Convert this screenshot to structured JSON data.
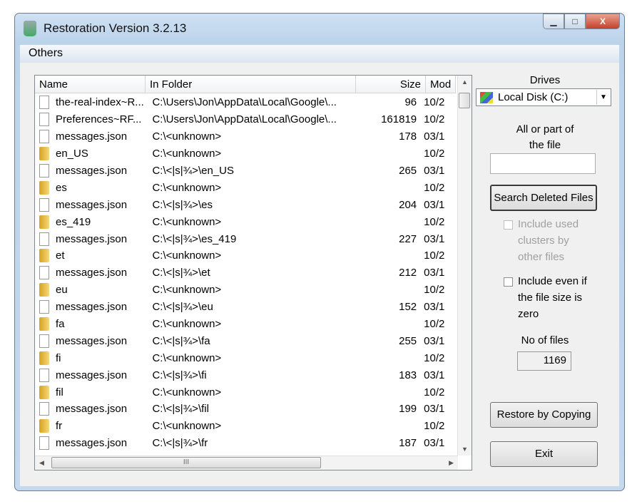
{
  "window": {
    "title": "Restoration Version 3.2.13",
    "minimize": "▁",
    "maximize": "□",
    "close": "X"
  },
  "menu": {
    "others": "Others"
  },
  "list": {
    "columns": [
      "Name",
      "In Folder",
      "Size",
      "Mod"
    ],
    "rows": [
      {
        "type": "file",
        "name": "the-real-index~R...",
        "folder": "C:\\Users\\Jon\\AppData\\Local\\Google\\...",
        "size": "96",
        "date": "10/2"
      },
      {
        "type": "file",
        "name": "Preferences~RF...",
        "folder": "C:\\Users\\Jon\\AppData\\Local\\Google\\...",
        "size": "161819",
        "date": "10/2"
      },
      {
        "type": "file",
        "name": "messages.json",
        "folder": "C:\\<unknown>",
        "size": "178",
        "date": "03/1"
      },
      {
        "type": "folder",
        "name": "en_US",
        "folder": "C:\\<unknown>",
        "size": "",
        "date": "10/2"
      },
      {
        "type": "file",
        "name": "messages.json",
        "folder": "C:\\<|s|¾>\\en_US",
        "size": "265",
        "date": "03/1"
      },
      {
        "type": "folder",
        "name": "es",
        "folder": "C:\\<unknown>",
        "size": "",
        "date": "10/2"
      },
      {
        "type": "file",
        "name": "messages.json",
        "folder": "C:\\<|s|¾>\\es",
        "size": "204",
        "date": "03/1"
      },
      {
        "type": "folder",
        "name": "es_419",
        "folder": "C:\\<unknown>",
        "size": "",
        "date": "10/2"
      },
      {
        "type": "file",
        "name": "messages.json",
        "folder": "C:\\<|s|¾>\\es_419",
        "size": "227",
        "date": "03/1"
      },
      {
        "type": "folder",
        "name": "et",
        "folder": "C:\\<unknown>",
        "size": "",
        "date": "10/2"
      },
      {
        "type": "file",
        "name": "messages.json",
        "folder": "C:\\<|s|¾>\\et",
        "size": "212",
        "date": "03/1"
      },
      {
        "type": "folder",
        "name": "eu",
        "folder": "C:\\<unknown>",
        "size": "",
        "date": "10/2"
      },
      {
        "type": "file",
        "name": "messages.json",
        "folder": "C:\\<|s|¾>\\eu",
        "size": "152",
        "date": "03/1"
      },
      {
        "type": "folder",
        "name": "fa",
        "folder": "C:\\<unknown>",
        "size": "",
        "date": "10/2"
      },
      {
        "type": "file",
        "name": "messages.json",
        "folder": "C:\\<|s|¾>\\fa",
        "size": "255",
        "date": "03/1"
      },
      {
        "type": "folder",
        "name": "fi",
        "folder": "C:\\<unknown>",
        "size": "",
        "date": "10/2"
      },
      {
        "type": "file",
        "name": "messages.json",
        "folder": "C:\\<|s|¾>\\fi",
        "size": "183",
        "date": "03/1"
      },
      {
        "type": "folder",
        "name": "fil",
        "folder": "C:\\<unknown>",
        "size": "",
        "date": "10/2"
      },
      {
        "type": "file",
        "name": "messages.json",
        "folder": "C:\\<|s|¾>\\fil",
        "size": "199",
        "date": "03/1"
      },
      {
        "type": "folder",
        "name": "fr",
        "folder": "C:\\<unknown>",
        "size": "",
        "date": "10/2"
      },
      {
        "type": "file",
        "name": "messages.json",
        "folder": "C:\\<|s|¾>\\fr",
        "size": "187",
        "date": "03/1"
      }
    ],
    "hscroll_grip": "III"
  },
  "panel": {
    "drives_label": "Drives",
    "drive_selected": "Local Disk (C:)",
    "file_label_1": "All or part of",
    "file_label_2": "the file",
    "file_input": "",
    "search_button": "Search Deleted Files",
    "include_used_1": "Include used",
    "include_used_2": "clusters by",
    "include_used_3": "other files",
    "include_zero_1": "Include even if",
    "include_zero_2": "the file size is",
    "include_zero_3": "zero",
    "nfiles_label": "No of files",
    "nfiles_value": "1169",
    "restore_button": "Restore by Copying",
    "exit_button": "Exit"
  }
}
